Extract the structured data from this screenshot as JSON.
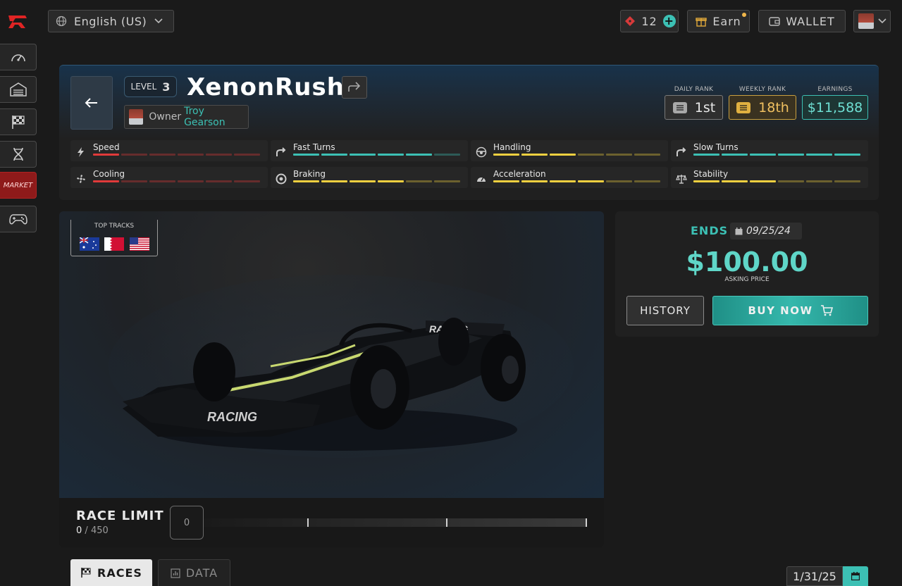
{
  "topbar": {
    "language": "English (US)",
    "tickets_count": "12",
    "earn_label": "Earn",
    "wallet_label": "WALLET"
  },
  "sidebar": {
    "items": [
      {
        "icon": "speedometer-icon"
      },
      {
        "icon": "garage-icon"
      },
      {
        "icon": "checkered-flag-icon"
      },
      {
        "icon": "dna-icon"
      },
      {
        "label": "MARKET"
      },
      {
        "icon": "gamepad-icon"
      }
    ]
  },
  "car": {
    "level_label": "LEVEL",
    "level": "3",
    "name": "XenonRush",
    "owner_label": "Owner",
    "owner_name": "Troy Gearson"
  },
  "ranks": {
    "daily_label": "DAILY RANK",
    "daily_value": "1st",
    "weekly_label": "WEEKLY RANK",
    "weekly_value": "18th",
    "earnings_label": "EARNINGS",
    "earnings_value": "$11,588"
  },
  "stats": [
    {
      "label": "Speed",
      "icon": "lightning-icon",
      "color": "#e03a3a",
      "level": 1
    },
    {
      "label": "Fast Turns",
      "icon": "turn-right-icon",
      "color": "#3cc0b4",
      "level": 5
    },
    {
      "label": "Handling",
      "icon": "steering-wheel-icon",
      "color": "#f0d040",
      "level": 3
    },
    {
      "label": "Slow Turns",
      "icon": "slow-turn-icon",
      "color": "#3cc0b4",
      "level": 6
    },
    {
      "label": "Cooling",
      "icon": "fan-icon",
      "color": "#e03a3a",
      "level": 1
    },
    {
      "label": "Braking",
      "icon": "brake-disc-icon",
      "color": "#f0d040",
      "level": 4
    },
    {
      "label": "Acceleration",
      "icon": "gauge-icon",
      "color": "#f0d040",
      "level": 4
    },
    {
      "label": "Stability",
      "icon": "scales-icon",
      "color": "#f0d040",
      "level": 3
    }
  ],
  "top_tracks": {
    "label": "TOP TRACKS",
    "flags": [
      "australia-flag",
      "bahrain-flag",
      "usa-flag"
    ]
  },
  "race_limit": {
    "title": "RACE LIMIT",
    "used": "0",
    "separator": "/",
    "total": "450",
    "input_value": "0",
    "progress": 0
  },
  "listing": {
    "ends_label": "ENDS",
    "end_date": "09/25/24",
    "price": "$100.00",
    "price_caption": "ASKING PRICE",
    "history_label": "HISTORY",
    "buy_label": "BUY NOW"
  },
  "tabs": [
    {
      "label": "RACES",
      "active": true
    },
    {
      "label": "DATA",
      "active": false
    }
  ],
  "date_filter": "1/31/25",
  "colors": {
    "accent": "#3cc0b4",
    "danger": "#e03a3a",
    "warning": "#f0d040",
    "gold": "#f0c060"
  }
}
